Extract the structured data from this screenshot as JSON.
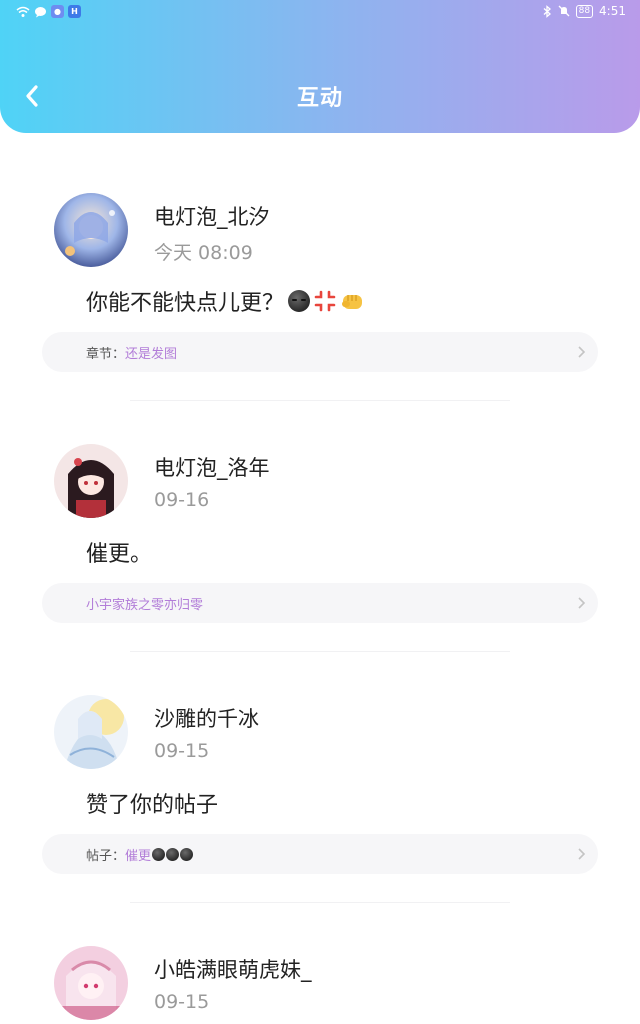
{
  "status_bar": {
    "time": "4:51",
    "battery": "88"
  },
  "header": {
    "title": "互动"
  },
  "items": [
    {
      "name": "电灯泡_北汐",
      "time": "今天 08:09",
      "content": "你能不能快点儿更？",
      "ref_label": "章节：",
      "ref_text": "还是发图"
    },
    {
      "name": "电灯泡_洛年",
      "time": "09-16",
      "content": "催更。",
      "ref_label": "",
      "ref_text": "小宇家族之零亦归零"
    },
    {
      "name": "沙雕的千冰",
      "time": "09-15",
      "content": "赞了你的帖子",
      "ref_label": "帖子：",
      "ref_text": "催更"
    },
    {
      "name": "小皓满眼萌虎妹_",
      "time": "09-15"
    }
  ],
  "colors": {
    "header_start": "#4fd3f6",
    "header_end": "#b99bea",
    "ref_text": "#b27dd8",
    "time": "#9a9a9a"
  }
}
